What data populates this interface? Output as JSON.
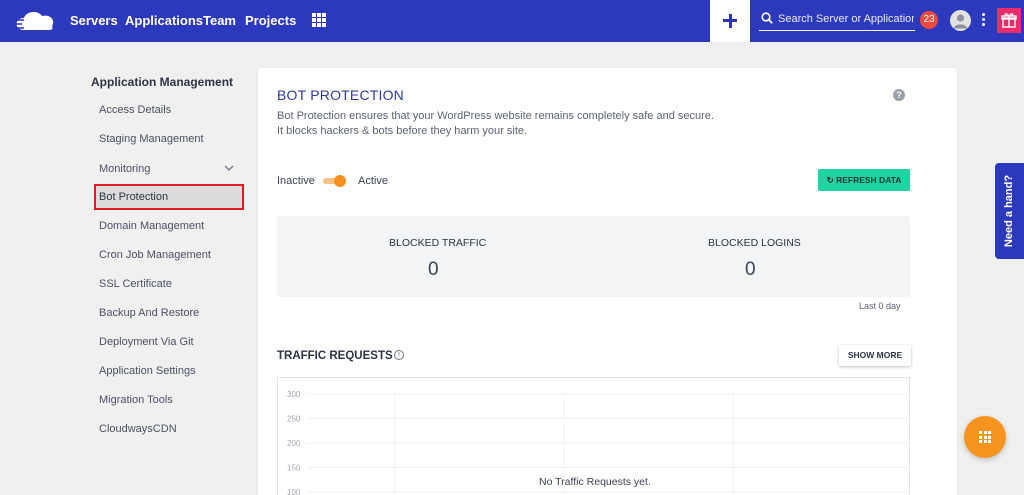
{
  "nav": {
    "links": [
      "Servers",
      "Applications",
      "Team",
      "Projects"
    ],
    "search_placeholder": "Search Server or Application",
    "notification_count": "23"
  },
  "sidebar": {
    "title": "Application Management",
    "items": [
      {
        "label": "Access Details"
      },
      {
        "label": "Staging Management"
      },
      {
        "label": "Monitoring"
      },
      {
        "label": "Bot Protection"
      },
      {
        "label": "Domain Management"
      },
      {
        "label": "Cron Job Management"
      },
      {
        "label": "SSL Certificate"
      },
      {
        "label": "Backup And Restore"
      },
      {
        "label": "Deployment Via Git"
      },
      {
        "label": "Application Settings"
      },
      {
        "label": "Migration Tools"
      },
      {
        "label": "CloudwaysCDN"
      }
    ],
    "active_item": "Bot Protection"
  },
  "main": {
    "title": "BOT PROTECTION",
    "description": "Bot Protection ensures that your WordPress website remains completely safe and secure. It blocks hackers & bots before they harm your site.",
    "toggle_off_label": "Inactive",
    "toggle_on_label": "Active",
    "toggle_state": "active",
    "refresh_label": "REFRESH DATA",
    "stats": [
      {
        "label": "BLOCKED TRAFFIC",
        "value": "0"
      },
      {
        "label": "BLOCKED LOGINS",
        "value": "0"
      }
    ],
    "period_label": "Last 0 day",
    "traffic_title": "TRAFFIC REQUESTS",
    "show_more_label": "SHOW MORE",
    "empty_message": "No Traffic Requests yet."
  },
  "chart_data": {
    "type": "line",
    "y_ticks": [
      "300",
      "250",
      "200",
      "150",
      "100"
    ],
    "series": [],
    "grid": true
  },
  "help_tab": "Need a hand?",
  "colors": {
    "brand": "#2c39bd",
    "accent": "#f78f1e",
    "refresh": "#1fd4a2",
    "highlight_border": "#e01b24"
  }
}
